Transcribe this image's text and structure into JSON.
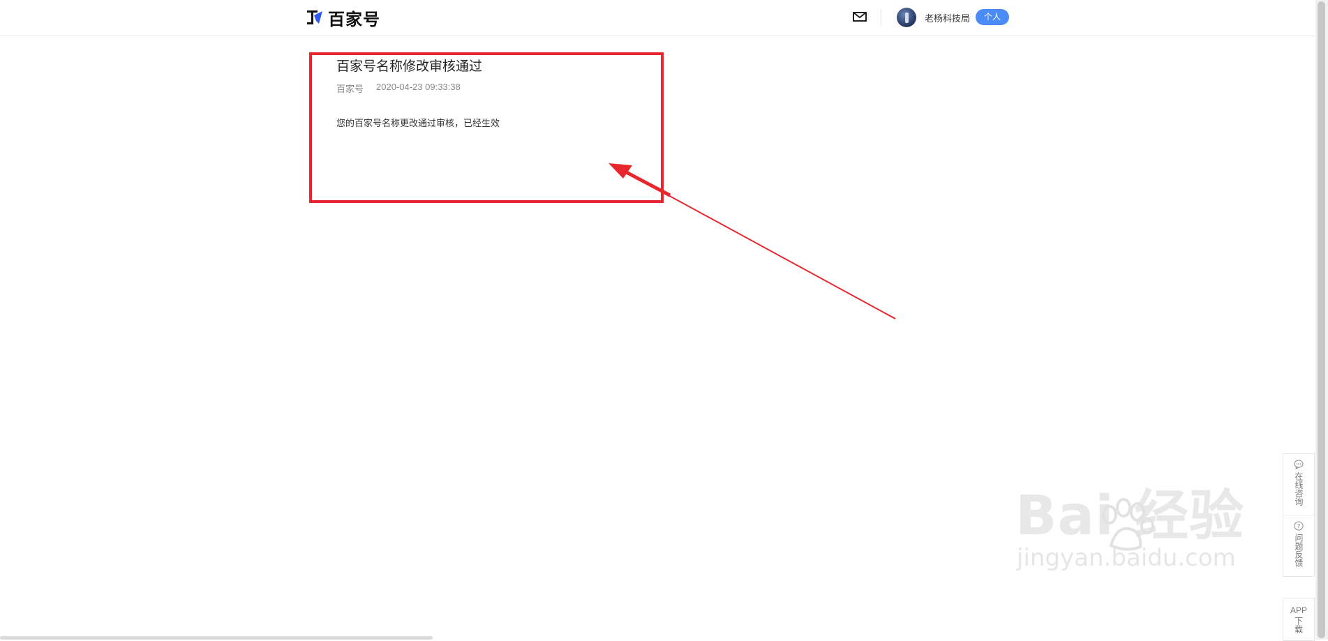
{
  "header": {
    "logo_text": "百家号",
    "username": "老杨科技局",
    "account_type": "个人"
  },
  "message": {
    "title": "百家号名称修改审核通过",
    "source": "百家号",
    "datetime": "2020-04-23 09:33:38",
    "body": "您的百家号名称更改通过审核，已经生效"
  },
  "side_tools": {
    "consult": "在线咨询",
    "feedback": "问题反馈",
    "app_line1": "APP",
    "app_line2": "下载"
  },
  "watermark": {
    "main": "Bai 经验",
    "sub": "jingyan.baidu.com"
  },
  "colors": {
    "accent": "#4b8bf5",
    "annotation": "#e8262d",
    "text": "#222222",
    "muted": "#888888"
  },
  "icons": [
    "logo-icon",
    "mail-icon",
    "chat-icon",
    "help-icon"
  ]
}
